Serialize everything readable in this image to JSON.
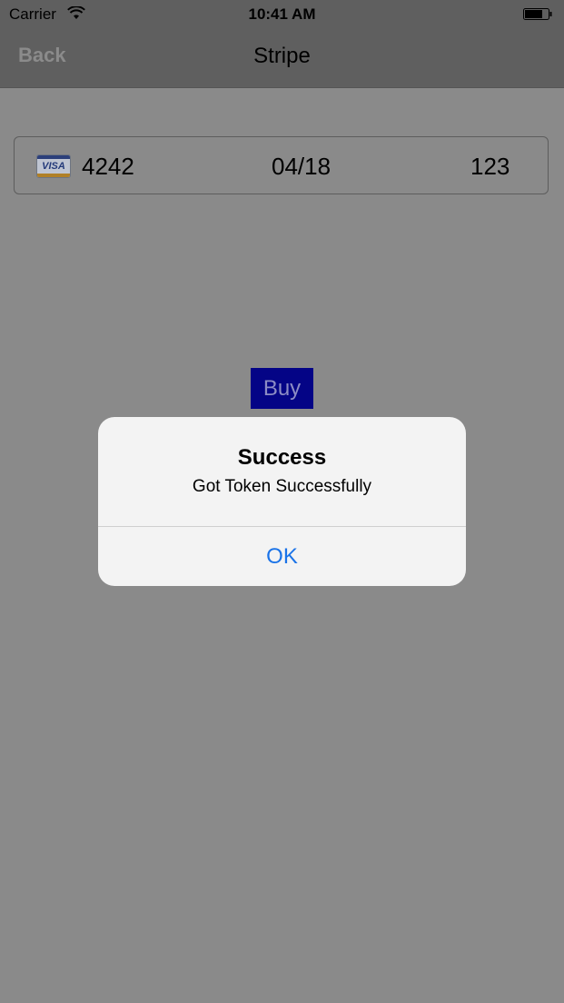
{
  "status_bar": {
    "carrier": "Carrier",
    "time": "10:41 AM",
    "icons": [
      "wifi-icon",
      "battery-icon"
    ]
  },
  "nav_bar": {
    "back_label": "Back",
    "title": "Stripe"
  },
  "card_field": {
    "brand_icon": "visa-card-icon",
    "brand_text": "VISA",
    "number": "4242",
    "expiry": "04/18",
    "cvc": "123"
  },
  "buy_button": {
    "label": "Buy",
    "color": "#040486"
  },
  "alert": {
    "title": "Success",
    "message": "Got Token Successfully",
    "ok_label": "OK",
    "ok_color": "#1a73e8"
  },
  "colors": {
    "overlay_background": "#8a8a8a",
    "alert_background": "#f3f3f3"
  }
}
